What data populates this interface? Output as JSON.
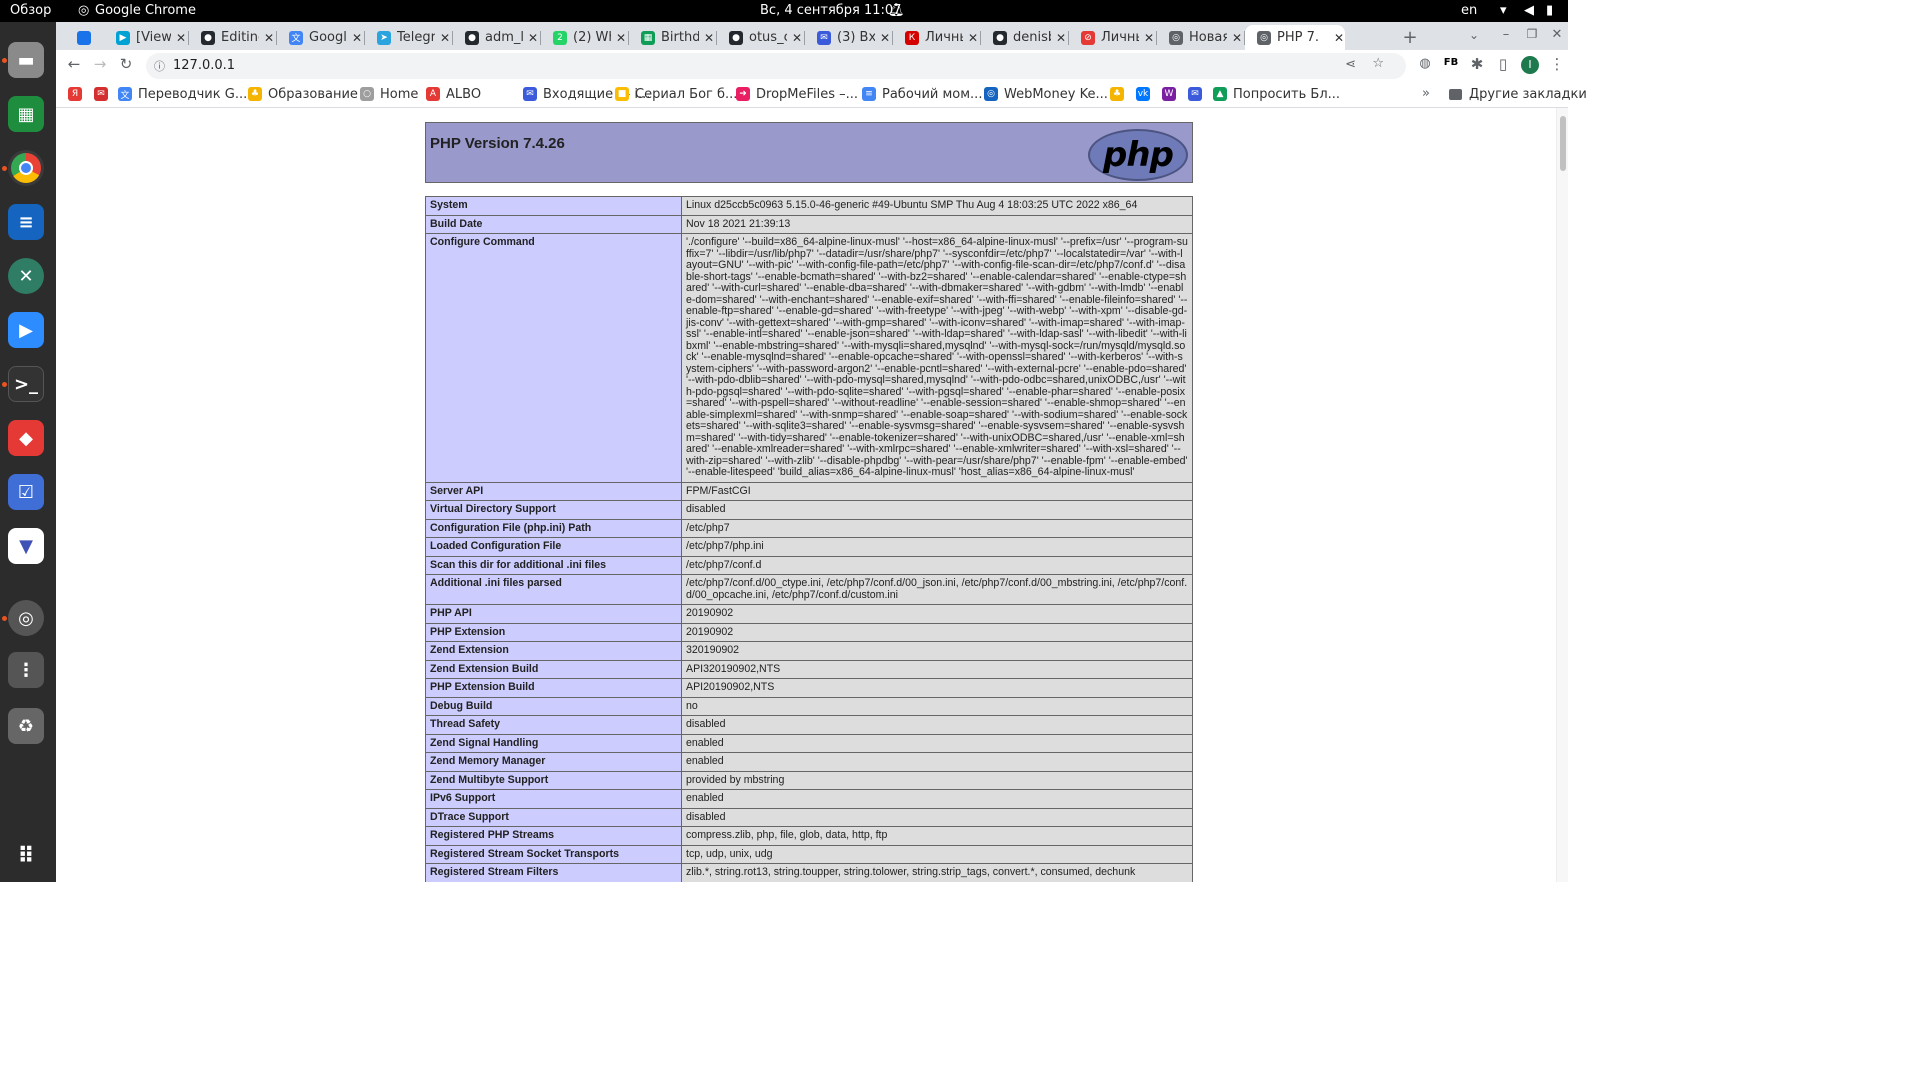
{
  "system_bar": {
    "overview": "Обзор",
    "app_name": "Google Chrome",
    "clock": "Вс, 4 сентября  11:07",
    "lang": "en"
  },
  "tabs": [
    {
      "label": "",
      "color": "#1a73e8",
      "glyph": ""
    },
    {
      "label": "[View]",
      "color": "#00a2d4",
      "glyph": "▶"
    },
    {
      "label": "Editing",
      "color": "#24292f",
      "glyph": "●"
    },
    {
      "label": "Google",
      "color": "#4285f4",
      "glyph": "文"
    },
    {
      "label": "Telegr",
      "color": "#2aa3df",
      "glyph": "➤"
    },
    {
      "label": "adm_li",
      "color": "#24292f",
      "glyph": "●"
    },
    {
      "label": "(2) Wh",
      "color": "#25d366",
      "glyph": "2"
    },
    {
      "label": "Birthd",
      "color": "#0f9d58",
      "glyph": "▦"
    },
    {
      "label": "otus_c",
      "color": "#24292f",
      "glyph": "●"
    },
    {
      "label": "(3) Вхо",
      "color": "#3b5bdb",
      "glyph": "✉"
    },
    {
      "label": "Личнь",
      "color": "#d50000",
      "glyph": "К"
    },
    {
      "label": "denisb",
      "color": "#24292f",
      "glyph": "●"
    },
    {
      "label": "Личнь",
      "color": "#e53935",
      "glyph": "⊘"
    },
    {
      "label": "Новая",
      "color": "#5f6368",
      "glyph": "◎"
    },
    {
      "label": "PHP 7.",
      "color": "#5f6368",
      "glyph": "◎"
    }
  ],
  "address": "127.0.0.1",
  "bookmarks": [
    {
      "label": "",
      "color": "#e53935",
      "glyph": "Я"
    },
    {
      "label": "",
      "color": "#d32f2f",
      "glyph": "✉"
    },
    {
      "label": "Переводчик G...",
      "color": "#4285f4",
      "glyph": "文"
    },
    {
      "label": "Образование",
      "color": "#f4b400",
      "glyph": "♣"
    },
    {
      "label": "Home",
      "color": "#9e9e9e",
      "glyph": "○"
    },
    {
      "label": "ALBO",
      "color": "#e53935",
      "glyph": "A"
    },
    {
      "label": "Входящие — i...",
      "color": "#3b5bdb",
      "glyph": "✉"
    },
    {
      "label": "Сериал Бог б...",
      "color": "#fbbc04",
      "glyph": "■"
    },
    {
      "label": "DropMeFiles –...",
      "color": "#e91e63",
      "glyph": "➜"
    },
    {
      "label": "Рабочий мом...",
      "color": "#4285f4",
      "glyph": "≡"
    },
    {
      "label": "WebMoney Ke...",
      "color": "#1565c0",
      "glyph": "◎"
    },
    {
      "label": "",
      "color": "#f4b400",
      "glyph": "♣"
    },
    {
      "label": "",
      "color": "#0077ff",
      "glyph": "vk"
    },
    {
      "label": "",
      "color": "#7b1fa2",
      "glyph": "W"
    },
    {
      "label": "",
      "color": "#3b5bdb",
      "glyph": "✉"
    },
    {
      "label": "Попросить Бл...",
      "color": "#0f9d58",
      "glyph": "▲"
    }
  ],
  "other_bookmarks": "Другие закладки",
  "php": {
    "title": "PHP Version 7.4.26",
    "logo": "php",
    "rows": [
      {
        "k": "System",
        "v": "Linux d25ccb5c0963 5.15.0-46-generic #49-Ubuntu SMP Thu Aug 4 18:03:25 UTC 2022 x86_64"
      },
      {
        "k": "Build Date",
        "v": "Nov 18 2021 21:39:13"
      },
      {
        "k": "Configure Command",
        "v": "'./configure' '--build=x86_64-alpine-linux-musl' '--host=x86_64-alpine-linux-musl' '--prefix=/usr' '--program-suffix=7' '--libdir=/usr/lib/php7' '--datadir=/usr/share/php7' '--sysconfdir=/etc/php7' '--localstatedir=/var' '--with-layout=GNU' '--with-pic' '--with-config-file-path=/etc/php7' '--with-config-file-scan-dir=/etc/php7/conf.d' '--disable-short-tags' '--enable-bcmath=shared' '--with-bz2=shared' '--enable-calendar=shared' '--enable-ctype=shared' '--with-curl=shared' '--enable-dba=shared' '--with-dbmaker=shared' '--with-gdbm' '--with-lmdb' '--enable-dom=shared' '--with-enchant=shared' '--enable-exif=shared' '--with-ffi=shared' '--enable-fileinfo=shared' '--enable-ftp=shared' '--enable-gd=shared' '--with-freetype' '--with-jpeg' '--with-webp' '--with-xpm' '--disable-gd-jis-conv' '--with-gettext=shared' '--with-gmp=shared' '--with-iconv=shared' '--with-imap=shared' '--with-imap-ssl' '--enable-intl=shared' '--enable-json=shared' '--with-ldap=shared' '--with-ldap-sasl' '--with-libedit' '--with-libxml' '--enable-mbstring=shared' '--with-mysqli=shared,mysqlnd' '--with-mysql-sock=/run/mysqld/mysqld.sock' '--enable-mysqlnd=shared' '--enable-opcache=shared' '--with-openssl=shared' '--with-kerberos' '--with-system-ciphers' '--with-password-argon2' '--enable-pcntl=shared' '--with-external-pcre' '--enable-pdo=shared' '--with-pdo-dblib=shared' '--with-pdo-mysql=shared,mysqlnd' '--with-pdo-odbc=shared,unixODBC,/usr' '--with-pdo-pgsql=shared' '--with-pdo-sqlite=shared' '--with-pgsql=shared' '--enable-phar=shared' '--enable-posix=shared' '--with-pspell=shared' '--without-readline' '--enable-session=shared' '--enable-shmop=shared' '--enable-simplexml=shared' '--with-snmp=shared' '--enable-soap=shared' '--with-sodium=shared' '--enable-sockets=shared' '--with-sqlite3=shared' '--enable-sysvmsg=shared' '--enable-sysvsem=shared' '--enable-sysvshm=shared' '--with-tidy=shared' '--enable-tokenizer=shared' '--with-unixODBC=shared,/usr' '--enable-xml=shared' '--enable-xmlreader=shared' '--with-xmlrpc=shared' '--enable-xmlwriter=shared' '--with-xsl=shared' '--with-zip=shared' '--with-zlib' '--disable-phpdbg' '--with-pear=/usr/share/php7' '--enable-fpm' '--enable-embed' '--enable-litespeed' 'build_alias=x86_64-alpine-linux-musl' 'host_alias=x86_64-alpine-linux-musl'"
      },
      {
        "k": "Server API",
        "v": "FPM/FastCGI"
      },
      {
        "k": "Virtual Directory Support",
        "v": "disabled"
      },
      {
        "k": "Configuration File (php.ini) Path",
        "v": "/etc/php7"
      },
      {
        "k": "Loaded Configuration File",
        "v": "/etc/php7/php.ini"
      },
      {
        "k": "Scan this dir for additional .ini files",
        "v": "/etc/php7/conf.d"
      },
      {
        "k": "Additional .ini files parsed",
        "v": "/etc/php7/conf.d/00_ctype.ini, /etc/php7/conf.d/00_json.ini, /etc/php7/conf.d/00_mbstring.ini, /etc/php7/conf.d/00_opcache.ini, /etc/php7/conf.d/custom.ini"
      },
      {
        "k": "PHP API",
        "v": "20190902"
      },
      {
        "k": "PHP Extension",
        "v": "20190902"
      },
      {
        "k": "Zend Extension",
        "v": "320190902"
      },
      {
        "k": "Zend Extension Build",
        "v": "API320190902,NTS"
      },
      {
        "k": "PHP Extension Build",
        "v": "API20190902,NTS"
      },
      {
        "k": "Debug Build",
        "v": "no"
      },
      {
        "k": "Thread Safety",
        "v": "disabled"
      },
      {
        "k": "Zend Signal Handling",
        "v": "enabled"
      },
      {
        "k": "Zend Memory Manager",
        "v": "enabled"
      },
      {
        "k": "Zend Multibyte Support",
        "v": "provided by mbstring"
      },
      {
        "k": "IPv6 Support",
        "v": "enabled"
      },
      {
        "k": "DTrace Support",
        "v": "disabled"
      },
      {
        "k": "Registered PHP Streams",
        "v": "compress.zlib, php, file, glob, data, http, ftp"
      },
      {
        "k": "Registered Stream Socket Transports",
        "v": "tcp, udp, unix, udg"
      },
      {
        "k": "Registered Stream Filters",
        "v": "zlib.*, string.rot13, string.toupper, string.tolower, string.strip_tags, convert.*, consumed, dechunk"
      }
    ]
  }
}
